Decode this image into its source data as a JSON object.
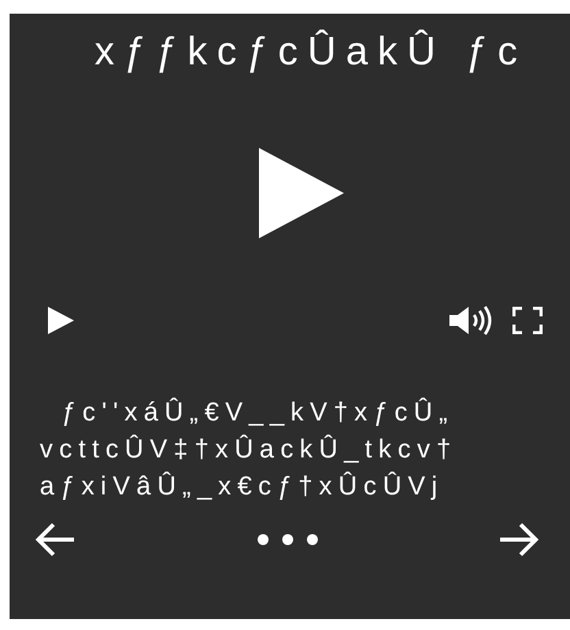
{
  "player": {
    "title": "xƒƒkcƒcÛakÛ ƒc",
    "captions": [
      "ƒc''xáÛ„€V__kV†xƒcÛ„",
      "vcttcÛV‡†xÛackÛ_tkcv†",
      "aƒxiVâÛ„_x€cƒ†xÛcÛVj"
    ]
  }
}
